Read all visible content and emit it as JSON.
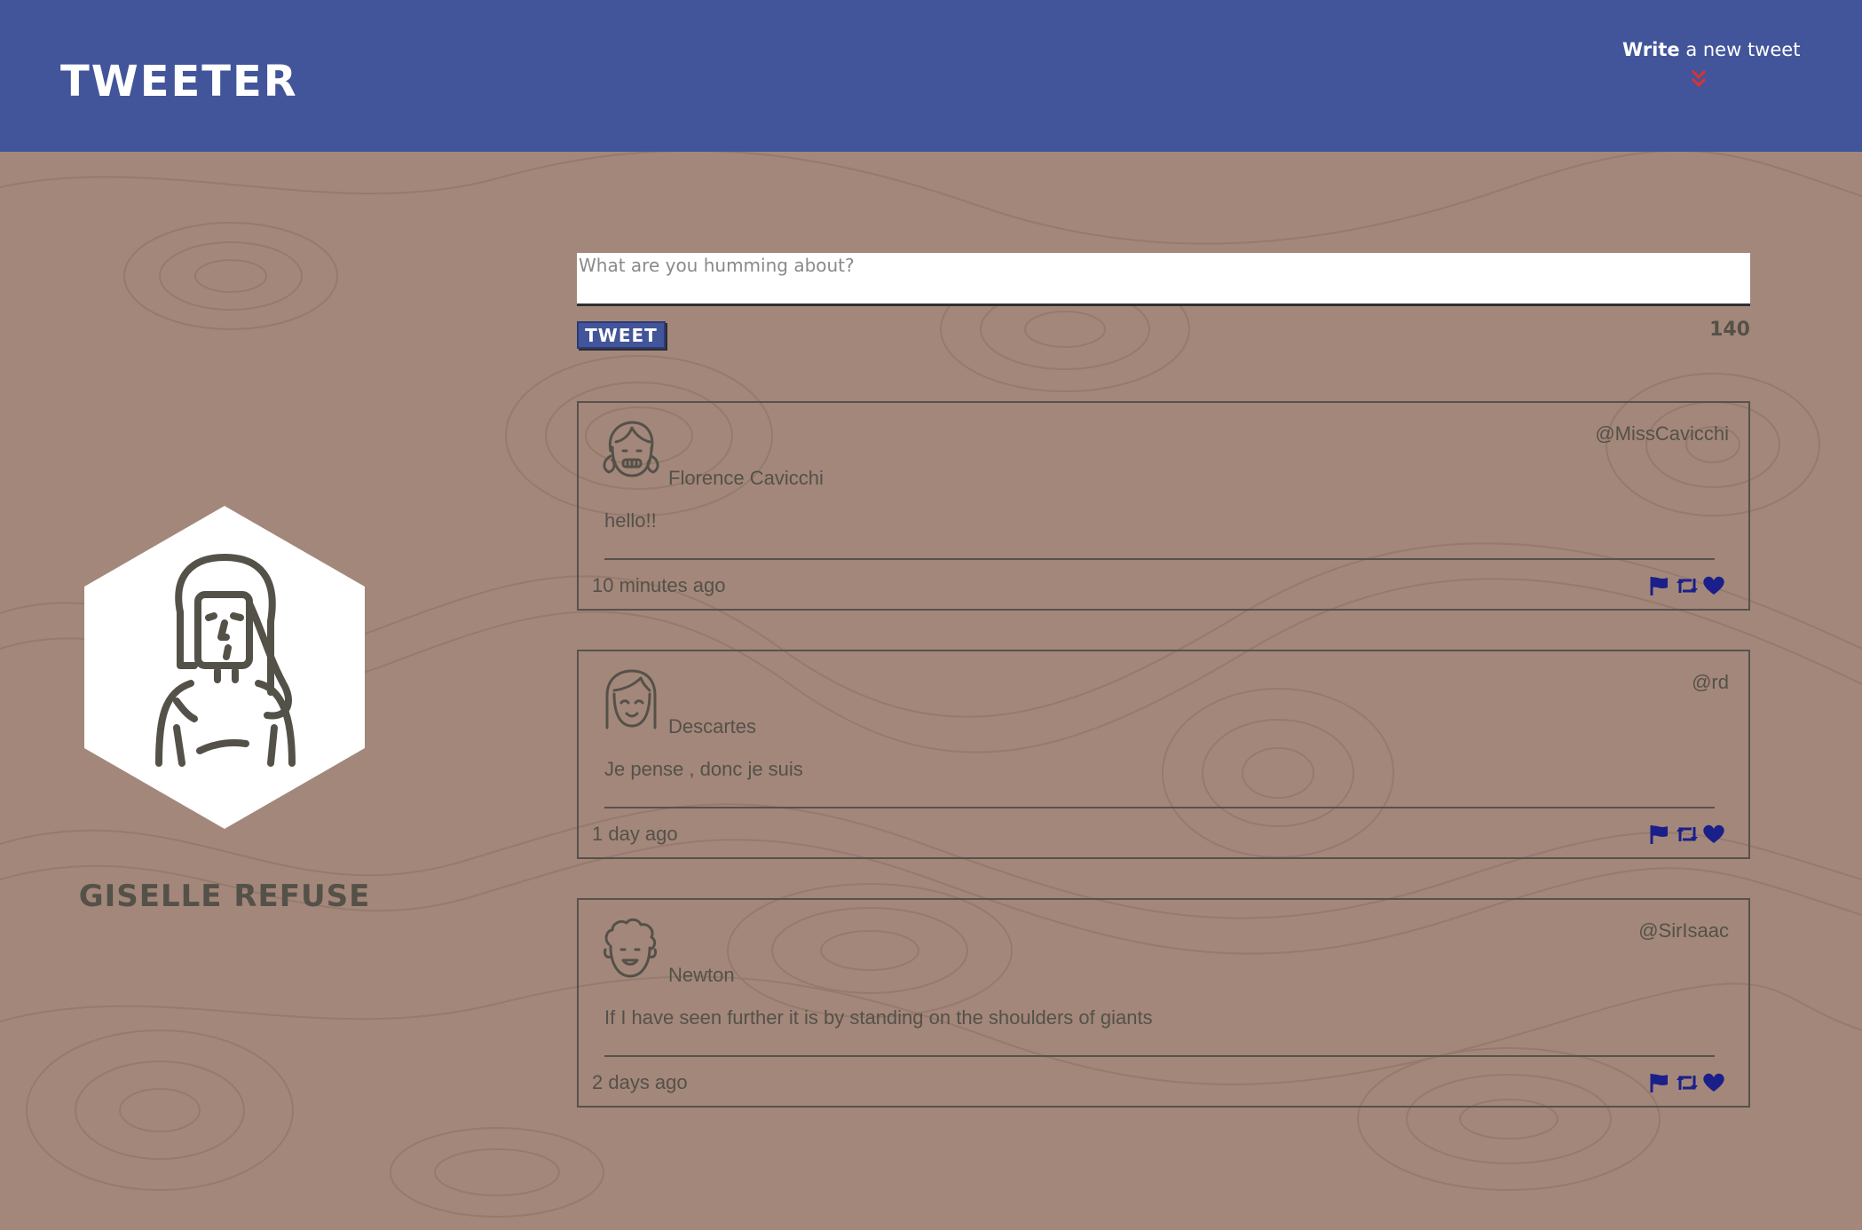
{
  "nav": {
    "brand": "Tweeter",
    "compose_bold": "Write",
    "compose_rest": " a new tweet",
    "chevron_icon": "double-chevron-down-icon",
    "background_color": "#42559a",
    "accent_color": "#e03030"
  },
  "profile": {
    "name": "Giselle Refuse",
    "avatar_icon": "woman-avatar-icon"
  },
  "composer": {
    "placeholder": "What are you humming about?",
    "value": "",
    "button_label": "Tweet",
    "counter": "140"
  },
  "tweets": [
    {
      "name": "Florence Cavicchi",
      "handle": "@MissCavicchi",
      "content": "hello!!",
      "time": "10 minutes ago",
      "avatar_icon": "girl-avatar-icon"
    },
    {
      "name": "Descartes",
      "handle": "@rd",
      "content": "Je pense , donc je suis",
      "time": "1 day ago",
      "avatar_icon": "smiling-woman-avatar-icon"
    },
    {
      "name": "Newton",
      "handle": "@SirIsaac",
      "content": "If I have seen further it is by standing on the shoulders of giants",
      "time": "2 days ago",
      "avatar_icon": "curly-hair-man-avatar-icon"
    }
  ],
  "actions": {
    "icons": [
      "flag-icon",
      "retweet-icon",
      "heart-icon"
    ],
    "color": "#1b1f8a"
  },
  "colors": {
    "page_background": "#a3877a",
    "text": "#545149"
  }
}
